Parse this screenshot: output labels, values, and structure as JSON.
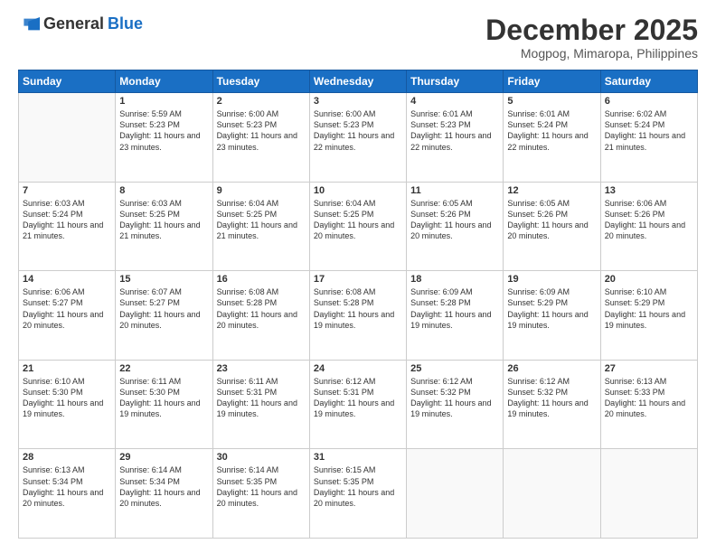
{
  "logo": {
    "general": "General",
    "blue": "Blue"
  },
  "header": {
    "month": "December 2025",
    "location": "Mogpog, Mimaropa, Philippines"
  },
  "weekdays": [
    "Sunday",
    "Monday",
    "Tuesday",
    "Wednesday",
    "Thursday",
    "Friday",
    "Saturday"
  ],
  "weeks": [
    [
      {
        "day": "",
        "sunrise": "",
        "sunset": "",
        "daylight": ""
      },
      {
        "day": "1",
        "sunrise": "Sunrise: 5:59 AM",
        "sunset": "Sunset: 5:23 PM",
        "daylight": "Daylight: 11 hours and 23 minutes."
      },
      {
        "day": "2",
        "sunrise": "Sunrise: 6:00 AM",
        "sunset": "Sunset: 5:23 PM",
        "daylight": "Daylight: 11 hours and 23 minutes."
      },
      {
        "day": "3",
        "sunrise": "Sunrise: 6:00 AM",
        "sunset": "Sunset: 5:23 PM",
        "daylight": "Daylight: 11 hours and 22 minutes."
      },
      {
        "day": "4",
        "sunrise": "Sunrise: 6:01 AM",
        "sunset": "Sunset: 5:23 PM",
        "daylight": "Daylight: 11 hours and 22 minutes."
      },
      {
        "day": "5",
        "sunrise": "Sunrise: 6:01 AM",
        "sunset": "Sunset: 5:24 PM",
        "daylight": "Daylight: 11 hours and 22 minutes."
      },
      {
        "day": "6",
        "sunrise": "Sunrise: 6:02 AM",
        "sunset": "Sunset: 5:24 PM",
        "daylight": "Daylight: 11 hours and 21 minutes."
      }
    ],
    [
      {
        "day": "7",
        "sunrise": "Sunrise: 6:03 AM",
        "sunset": "Sunset: 5:24 PM",
        "daylight": "Daylight: 11 hours and 21 minutes."
      },
      {
        "day": "8",
        "sunrise": "Sunrise: 6:03 AM",
        "sunset": "Sunset: 5:25 PM",
        "daylight": "Daylight: 11 hours and 21 minutes."
      },
      {
        "day": "9",
        "sunrise": "Sunrise: 6:04 AM",
        "sunset": "Sunset: 5:25 PM",
        "daylight": "Daylight: 11 hours and 21 minutes."
      },
      {
        "day": "10",
        "sunrise": "Sunrise: 6:04 AM",
        "sunset": "Sunset: 5:25 PM",
        "daylight": "Daylight: 11 hours and 20 minutes."
      },
      {
        "day": "11",
        "sunrise": "Sunrise: 6:05 AM",
        "sunset": "Sunset: 5:26 PM",
        "daylight": "Daylight: 11 hours and 20 minutes."
      },
      {
        "day": "12",
        "sunrise": "Sunrise: 6:05 AM",
        "sunset": "Sunset: 5:26 PM",
        "daylight": "Daylight: 11 hours and 20 minutes."
      },
      {
        "day": "13",
        "sunrise": "Sunrise: 6:06 AM",
        "sunset": "Sunset: 5:26 PM",
        "daylight": "Daylight: 11 hours and 20 minutes."
      }
    ],
    [
      {
        "day": "14",
        "sunrise": "Sunrise: 6:06 AM",
        "sunset": "Sunset: 5:27 PM",
        "daylight": "Daylight: 11 hours and 20 minutes."
      },
      {
        "day": "15",
        "sunrise": "Sunrise: 6:07 AM",
        "sunset": "Sunset: 5:27 PM",
        "daylight": "Daylight: 11 hours and 20 minutes."
      },
      {
        "day": "16",
        "sunrise": "Sunrise: 6:08 AM",
        "sunset": "Sunset: 5:28 PM",
        "daylight": "Daylight: 11 hours and 20 minutes."
      },
      {
        "day": "17",
        "sunrise": "Sunrise: 6:08 AM",
        "sunset": "Sunset: 5:28 PM",
        "daylight": "Daylight: 11 hours and 19 minutes."
      },
      {
        "day": "18",
        "sunrise": "Sunrise: 6:09 AM",
        "sunset": "Sunset: 5:28 PM",
        "daylight": "Daylight: 11 hours and 19 minutes."
      },
      {
        "day": "19",
        "sunrise": "Sunrise: 6:09 AM",
        "sunset": "Sunset: 5:29 PM",
        "daylight": "Daylight: 11 hours and 19 minutes."
      },
      {
        "day": "20",
        "sunrise": "Sunrise: 6:10 AM",
        "sunset": "Sunset: 5:29 PM",
        "daylight": "Daylight: 11 hours and 19 minutes."
      }
    ],
    [
      {
        "day": "21",
        "sunrise": "Sunrise: 6:10 AM",
        "sunset": "Sunset: 5:30 PM",
        "daylight": "Daylight: 11 hours and 19 minutes."
      },
      {
        "day": "22",
        "sunrise": "Sunrise: 6:11 AM",
        "sunset": "Sunset: 5:30 PM",
        "daylight": "Daylight: 11 hours and 19 minutes."
      },
      {
        "day": "23",
        "sunrise": "Sunrise: 6:11 AM",
        "sunset": "Sunset: 5:31 PM",
        "daylight": "Daylight: 11 hours and 19 minutes."
      },
      {
        "day": "24",
        "sunrise": "Sunrise: 6:12 AM",
        "sunset": "Sunset: 5:31 PM",
        "daylight": "Daylight: 11 hours and 19 minutes."
      },
      {
        "day": "25",
        "sunrise": "Sunrise: 6:12 AM",
        "sunset": "Sunset: 5:32 PM",
        "daylight": "Daylight: 11 hours and 19 minutes."
      },
      {
        "day": "26",
        "sunrise": "Sunrise: 6:12 AM",
        "sunset": "Sunset: 5:32 PM",
        "daylight": "Daylight: 11 hours and 19 minutes."
      },
      {
        "day": "27",
        "sunrise": "Sunrise: 6:13 AM",
        "sunset": "Sunset: 5:33 PM",
        "daylight": "Daylight: 11 hours and 20 minutes."
      }
    ],
    [
      {
        "day": "28",
        "sunrise": "Sunrise: 6:13 AM",
        "sunset": "Sunset: 5:34 PM",
        "daylight": "Daylight: 11 hours and 20 minutes."
      },
      {
        "day": "29",
        "sunrise": "Sunrise: 6:14 AM",
        "sunset": "Sunset: 5:34 PM",
        "daylight": "Daylight: 11 hours and 20 minutes."
      },
      {
        "day": "30",
        "sunrise": "Sunrise: 6:14 AM",
        "sunset": "Sunset: 5:35 PM",
        "daylight": "Daylight: 11 hours and 20 minutes."
      },
      {
        "day": "31",
        "sunrise": "Sunrise: 6:15 AM",
        "sunset": "Sunset: 5:35 PM",
        "daylight": "Daylight: 11 hours and 20 minutes."
      },
      {
        "day": "",
        "sunrise": "",
        "sunset": "",
        "daylight": ""
      },
      {
        "day": "",
        "sunrise": "",
        "sunset": "",
        "daylight": ""
      },
      {
        "day": "",
        "sunrise": "",
        "sunset": "",
        "daylight": ""
      }
    ]
  ]
}
